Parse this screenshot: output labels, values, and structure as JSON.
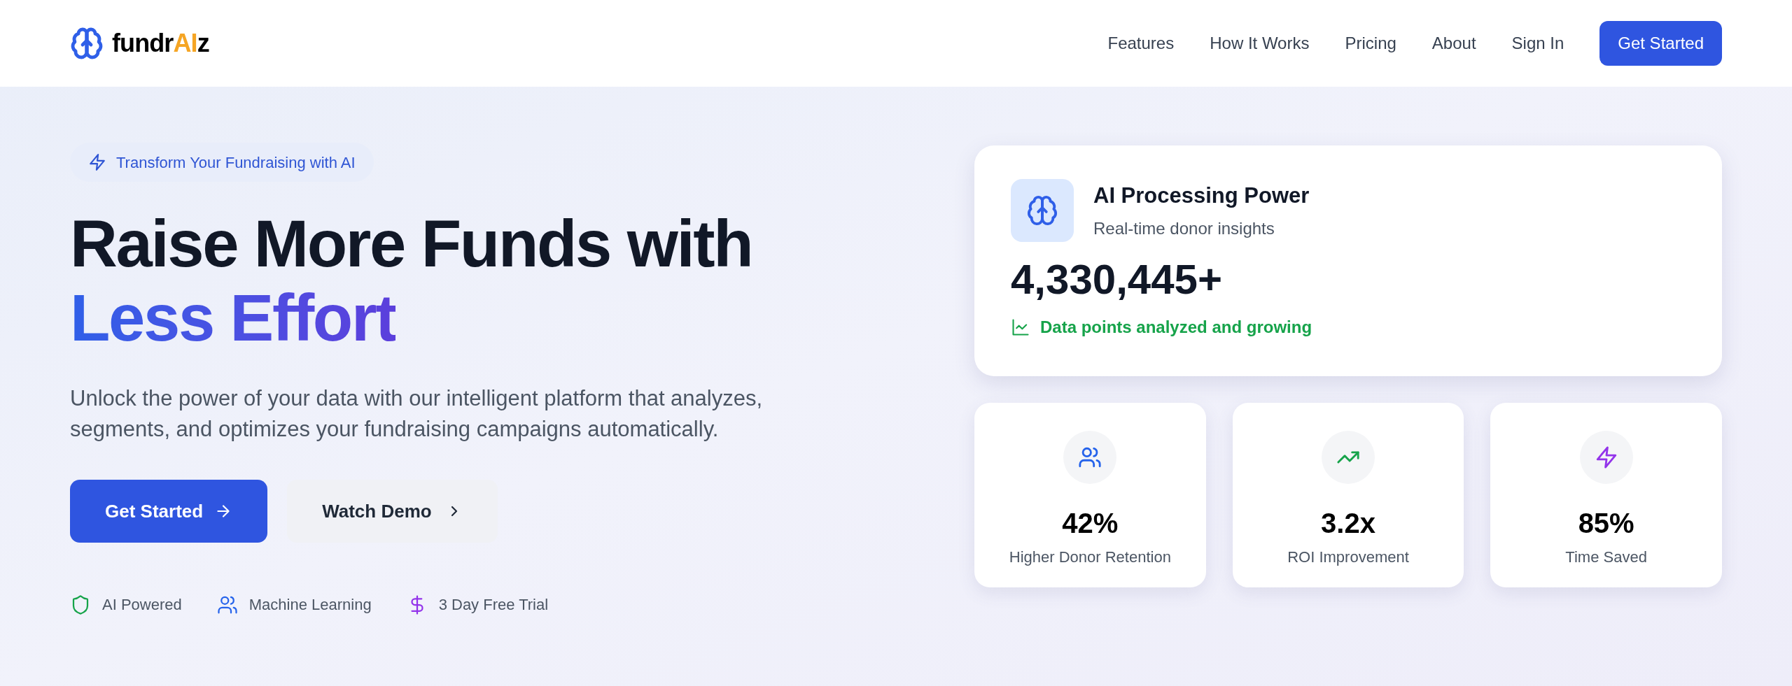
{
  "header": {
    "logo": {
      "parts": [
        {
          "text": "fundr",
          "kind": "plain"
        },
        {
          "text": "AI",
          "kind": "accent"
        },
        {
          "text": "z",
          "kind": "plain"
        }
      ]
    },
    "nav": [
      "Features",
      "How It Works",
      "Pricing",
      "About",
      "Sign In"
    ],
    "cta": "Get Started"
  },
  "hero": {
    "badge": "Transform Your Fundraising with AI",
    "headline": {
      "line_1": "Raise More Funds with",
      "line_2": "Less Effort"
    },
    "description": "Unlock the power of your data with our intelligent platform that analyzes, segments, and optimizes your fundraising campaigns automatically.",
    "buttons": [
      {
        "label": "Get Started",
        "kind": "primary"
      },
      {
        "label": "Watch Demo",
        "kind": "secondary"
      }
    ],
    "features": [
      {
        "label": "AI Powered",
        "kind": "shield",
        "color": "#16a34a"
      },
      {
        "label": "Machine Learning",
        "kind": "users",
        "color": "#2563eb"
      },
      {
        "label": "3 Day Free Trial",
        "kind": "dollar",
        "color": "#9333ea"
      }
    ]
  },
  "processing_card": {
    "title": "AI Processing Power",
    "subtitle": "Real-time donor insights",
    "value": "4,330,445+",
    "note": "Data points analyzed and growing"
  },
  "stats": [
    {
      "value": "42%",
      "label": "Higher Donor Retention",
      "kind": "users",
      "color": "#2563eb"
    },
    {
      "value": "3.2x",
      "label": "ROI Improvement",
      "kind": "trend",
      "color": "#16a34a"
    },
    {
      "value": "85%",
      "label": "Time Saved",
      "kind": "bolt",
      "color": "#9333ea"
    }
  ]
}
